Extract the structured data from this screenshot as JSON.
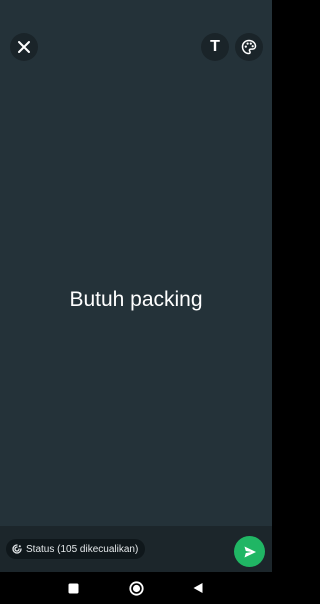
{
  "toolbar": {
    "close_icon": "close-icon",
    "text_tool_label": "T",
    "palette_icon": "palette-icon"
  },
  "status": {
    "text": "Butuh packing",
    "background_color": "#243239"
  },
  "composer": {
    "audience_icon": "status-privacy-icon",
    "audience_label": "Status (105 dikecualikan)",
    "send_icon": "send-icon",
    "send_color": "#20b664"
  },
  "navigation": {
    "recents_icon": "square-recents-icon",
    "home_icon": "circle-home-icon",
    "back_icon": "triangle-back-icon"
  }
}
